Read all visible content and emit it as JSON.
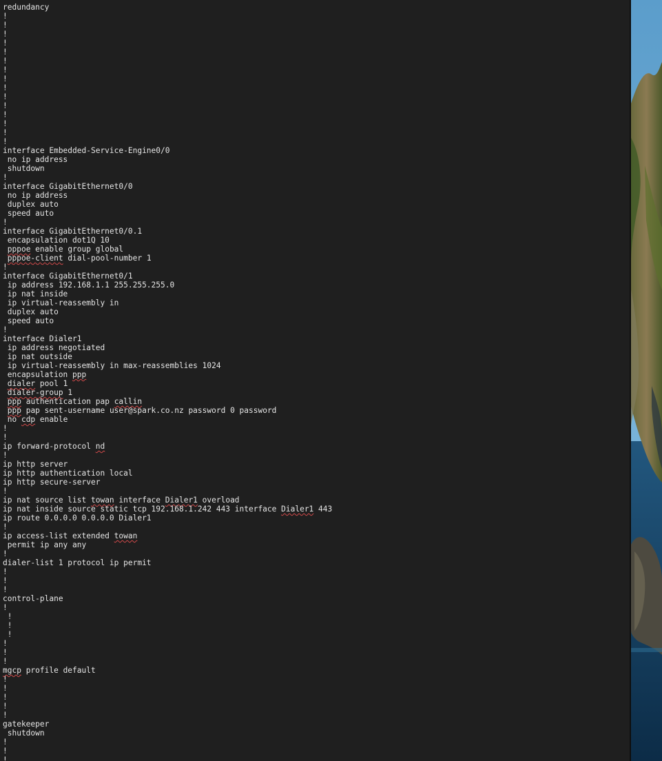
{
  "editor": {
    "lines": [
      [
        "redundancy"
      ],
      [
        "!"
      ],
      [
        "!"
      ],
      [
        "!"
      ],
      [
        "!"
      ],
      [
        "!"
      ],
      [
        "!"
      ],
      [
        "!"
      ],
      [
        "!"
      ],
      [
        "!"
      ],
      [
        "!"
      ],
      [
        "!"
      ],
      [
        "!"
      ],
      [
        "!"
      ],
      [
        "!"
      ],
      [
        "!"
      ],
      [
        "interface Embedded-Service-Engine0/0"
      ],
      [
        " no ip address"
      ],
      [
        " shutdown"
      ],
      [
        "!"
      ],
      [
        "interface GigabitEthernet0/0"
      ],
      [
        " no ip address"
      ],
      [
        " duplex auto"
      ],
      [
        " speed auto"
      ],
      [
        "!"
      ],
      [
        "interface GigabitEthernet0/0.1"
      ],
      [
        " encapsulation dot1Q 10"
      ],
      [
        " ",
        {
          "t": "pppoe",
          "spell": true
        },
        " enable group global"
      ],
      [
        " ",
        {
          "t": "pppoe-client",
          "spell": true
        },
        " dial-pool-number 1"
      ],
      [
        "!"
      ],
      [
        "interface GigabitEthernet0/1"
      ],
      [
        " ip address 192.168.1.1 255.255.255.0"
      ],
      [
        " ip nat inside"
      ],
      [
        " ip virtual-reassembly in"
      ],
      [
        " duplex auto"
      ],
      [
        " speed auto"
      ],
      [
        "!"
      ],
      [
        "interface Dialer1"
      ],
      [
        " ip address negotiated"
      ],
      [
        " ip nat outside"
      ],
      [
        " ip virtual-reassembly in max-reassemblies 1024"
      ],
      [
        " encapsulation ",
        {
          "t": "ppp",
          "spell": true
        }
      ],
      [
        " ",
        {
          "t": "dialer",
          "spell": true
        },
        " pool 1"
      ],
      [
        " ",
        {
          "t": "dialer-group",
          "spell": true
        },
        " 1"
      ],
      [
        " ",
        {
          "t": "ppp",
          "spell": true
        },
        " authentication pap ",
        {
          "t": "callin",
          "spell": true
        }
      ],
      [
        " ",
        {
          "t": "ppp",
          "spell": true
        },
        " pap sent-username user@spark.co.nz password 0 password"
      ],
      [
        " no ",
        {
          "t": "cdp",
          "spell": true
        },
        " enable"
      ],
      [
        "!"
      ],
      [
        "!"
      ],
      [
        "ip forward-protocol ",
        {
          "t": "nd",
          "spell": true
        }
      ],
      [
        "!"
      ],
      [
        "ip http server"
      ],
      [
        "ip http authentication local"
      ],
      [
        "ip http secure-server"
      ],
      [
        "!"
      ],
      [
        "ip nat source list ",
        {
          "t": "towan",
          "spell": true
        },
        " interface ",
        {
          "t": "Dialer1",
          "spell": true
        },
        " overload"
      ],
      [
        "ip nat inside source static tcp 192.168.1.242 443 interface ",
        {
          "t": "Dialer1",
          "spell": true
        },
        " 443"
      ],
      [
        "ip route 0.0.0.0 0.0.0.0 Dialer1"
      ],
      [
        "!"
      ],
      [
        "ip access-list extended ",
        {
          "t": "towan",
          "spell": true
        }
      ],
      [
        " permit ip any any"
      ],
      [
        "!"
      ],
      [
        "dialer-list 1 protocol ip permit"
      ],
      [
        "!"
      ],
      [
        "!"
      ],
      [
        "!"
      ],
      [
        "control-plane"
      ],
      [
        "!"
      ],
      [
        " !"
      ],
      [
        " !"
      ],
      [
        " !"
      ],
      [
        "!"
      ],
      [
        "!"
      ],
      [
        "!"
      ],
      [
        {
          "t": "mgcp",
          "spell": true
        },
        " profile default"
      ],
      [
        "!"
      ],
      [
        "!"
      ],
      [
        "!"
      ],
      [
        "!"
      ],
      [
        "!"
      ],
      [
        "gatekeeper"
      ],
      [
        " shutdown"
      ],
      [
        "!"
      ],
      [
        "!"
      ],
      [
        "!"
      ]
    ],
    "colors": {
      "background": "#1f1f1f",
      "text": "#e6e6e6",
      "spellcheck_underline": "#d44a4a"
    }
  },
  "desktop": {
    "wallpaper": "mountain-coast-landscape"
  }
}
